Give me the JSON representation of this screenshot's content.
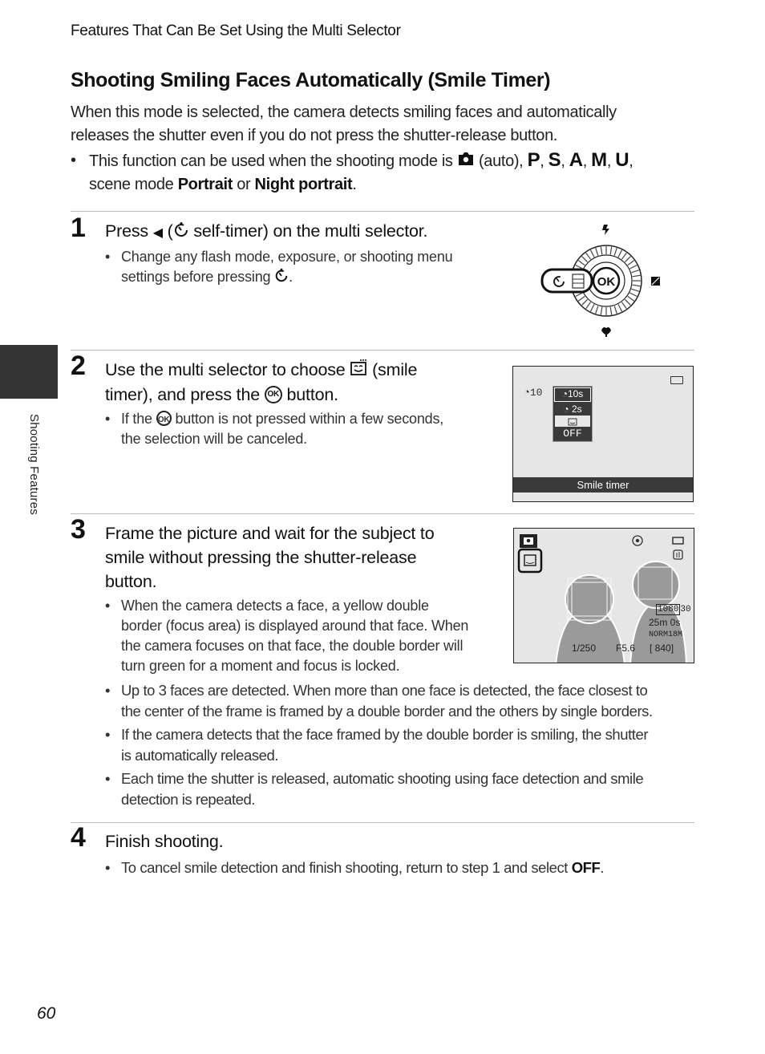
{
  "header": {
    "running_title": "Features That Can Be Set Using the Multi Selector"
  },
  "section": {
    "title": "Shooting Smiling Faces Automatically (Smile Timer)",
    "intro_line1": "When this mode is selected, the camera detects smiling faces and automatically",
    "intro_line2": "releases the shutter even if you do not press the shutter-release button.",
    "modes_bullet": {
      "prefix": "This function can be used when the shooting mode is",
      "auto_label": "(auto),",
      "modes": [
        "P",
        "S",
        "A",
        "M",
        "U"
      ],
      "scene_prefix": "scene mode",
      "portrait": "Portrait",
      "or": "or",
      "night_portrait": "Night portrait",
      "suffix": "."
    }
  },
  "steps": [
    {
      "number": "1",
      "title_pre": "Press",
      "title_mid": "self-timer) on the multi selector.",
      "bullets": [
        {
          "line1": "Change any flash mode, exposure, or shooting menu",
          "line2": "settings before pressing",
          "line2_end": "."
        }
      ],
      "figure": {
        "center_label": "OK"
      }
    },
    {
      "number": "2",
      "title_line1_pre": "Use the multi selector to choose",
      "title_line1_post": "(smile",
      "title_line2_pre": "timer), and press the",
      "title_line2_post": "button.",
      "bullets": [
        {
          "line1_pre": "If the",
          "line1_post": "button is not pressed within a few seconds,",
          "line2": "the selection will be canceled."
        }
      ],
      "screen": {
        "current_setting": "10",
        "menu_items": [
          "10s",
          "2s",
          "smile",
          "OFF"
        ],
        "selected_index": 2,
        "caption": "Smile timer"
      }
    },
    {
      "number": "3",
      "title_lines": [
        "Frame the picture and wait for the subject to",
        "smile without pressing the shutter-release",
        "button."
      ],
      "bullet_first_lines": [
        "When the camera detects a face, a yellow double",
        "border (focus area) is displayed around that face. When",
        "the camera focuses on that face, the double border will",
        "turn green for a moment and focus is locked."
      ],
      "bullets_more": [
        {
          "line1": "Up to 3 faces are detected. When more than one face is detected, the face closest to",
          "line2": "the center of the frame is framed by a double border and the others by single borders."
        },
        {
          "line1": "If the camera detects that the face framed by the double border is smiling, the shutter",
          "line2": "is automatically released."
        },
        {
          "line1": "Each time the shutter is released, automatic shooting using face detection and smile",
          "line2": "detection is repeated."
        }
      ],
      "screen": {
        "shutter_speed": "1/250",
        "aperture": "F5.6",
        "movie_size": "1080",
        "movie_fps": "30",
        "remaining_time": "25m 0s",
        "image_quality": "NORM",
        "image_size": "18M",
        "exposures_remaining": "[ 840]"
      }
    },
    {
      "number": "4",
      "title": "Finish shooting.",
      "bullets": [
        {
          "pre": "To cancel smile detection and finish shooting, return to step 1 and select",
          "bold": "OFF",
          "post": "."
        }
      ]
    }
  ],
  "side_tab": {
    "label": "Shooting Features"
  },
  "footer": {
    "page_number": "60"
  }
}
